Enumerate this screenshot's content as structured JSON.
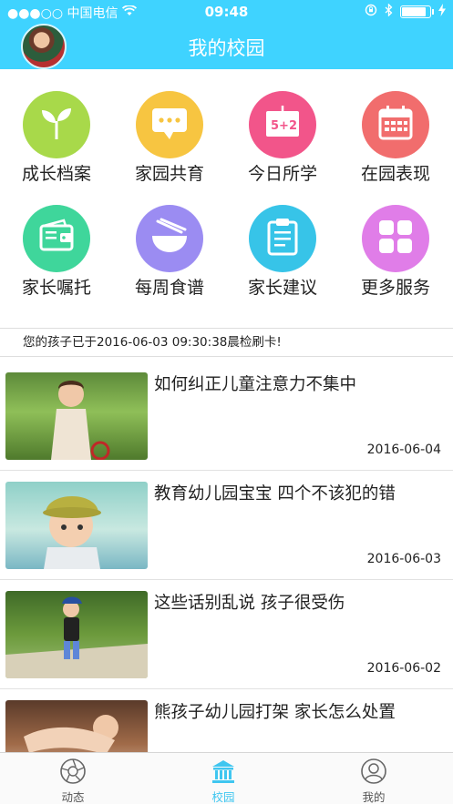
{
  "status_bar": {
    "carrier": "●●●○○ 中国电信",
    "time": "09:48"
  },
  "nav": {
    "title": "我的校园"
  },
  "grid": [
    {
      "label": "成长档案",
      "icon": "sprout-icon",
      "color": "#a8d94a"
    },
    {
      "label": "家园共育",
      "icon": "chat-bubble-icon",
      "color": "#f7c541"
    },
    {
      "label": "今日所学",
      "icon": "blackboard-icon",
      "color": "#f2558a"
    },
    {
      "label": "在园表现",
      "icon": "calendar-icon",
      "color": "#f16d6d"
    },
    {
      "label": "家长嘱托",
      "icon": "wallet-icon",
      "color": "#3fd69b"
    },
    {
      "label": "每周食谱",
      "icon": "bowl-chopsticks-icon",
      "color": "#9b8cf2"
    },
    {
      "label": "家长建议",
      "icon": "clipboard-icon",
      "color": "#37c4e8"
    },
    {
      "label": "更多服务",
      "icon": "grid-squares-icon",
      "color": "#e07de8"
    }
  ],
  "notice": "您的孩子已于2016-06-03 09:30:38晨检刷卡!",
  "news": [
    {
      "title": "如何纠正儿童注意力不集中",
      "date": "2016-06-04"
    },
    {
      "title": "教育幼儿园宝宝  四个不该犯的错",
      "date": "2016-06-03"
    },
    {
      "title": "这些话别乱说  孩子很受伤",
      "date": "2016-06-02"
    },
    {
      "title": "熊孩子幼儿园打架  家长怎么处置",
      "date": ""
    }
  ],
  "tabs": [
    {
      "label": "动态",
      "icon": "aperture-icon",
      "active": false
    },
    {
      "label": "校园",
      "icon": "school-building-icon",
      "active": true
    },
    {
      "label": "我的",
      "icon": "user-circle-icon",
      "active": false
    }
  ]
}
